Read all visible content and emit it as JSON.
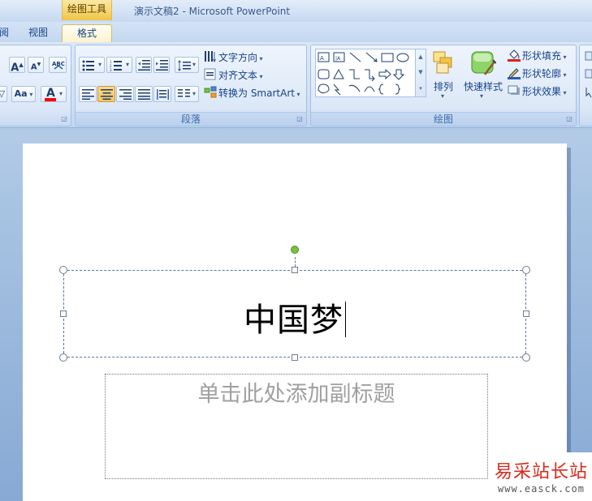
{
  "window": {
    "title": "演示文稿2 - Microsoft PowerPoint",
    "context_tab_header": "绘图工具"
  },
  "tabs": [
    {
      "label": "阅",
      "active": false
    },
    {
      "label": "视图",
      "active": false
    },
    {
      "label": "格式",
      "active": true
    }
  ],
  "ribbon": {
    "font_group": {
      "grow_font": "A",
      "shrink_font": "A",
      "clear_format": "ABC",
      "change_case": "Aa",
      "font_color": "A",
      "font_color_hex": "#ff0000"
    },
    "paragraph_group": {
      "label": "段落",
      "text_direction": "文字方向",
      "align_text": "对齐文本",
      "convert_smartart": "转换为 SmartArt"
    },
    "drawing_group": {
      "label": "绘图",
      "arrange": "排列",
      "quick_styles": "快速样式",
      "shape_fill": "形状填充",
      "shape_outline": "形状轮廓",
      "shape_effects": "形状效果"
    }
  },
  "slide": {
    "title_text": "中国梦",
    "subtitle_placeholder": "单击此处添加副标题"
  },
  "watermark": {
    "name": "易采站长站",
    "url": "www.easck.com"
  },
  "colors": {
    "accent": "#15428b",
    "context_tab": "#f5d56b",
    "rotate_handle": "#7ac142"
  }
}
